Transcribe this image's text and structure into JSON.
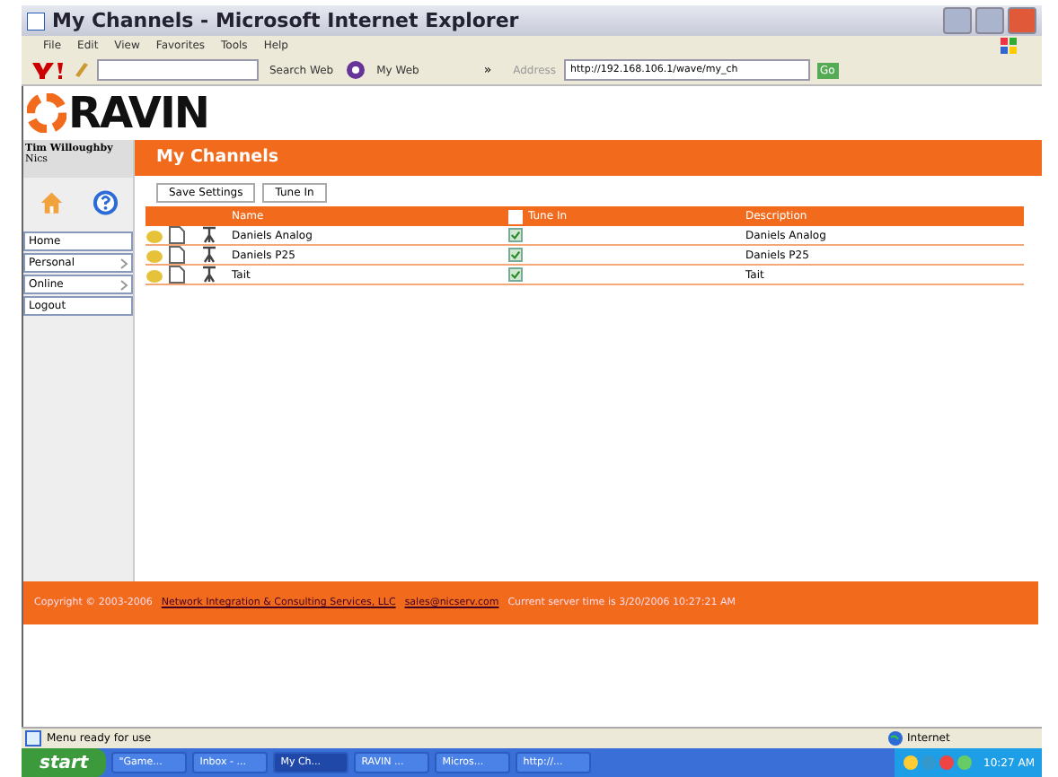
{
  "window": {
    "title": "My Channels - Microsoft Internet Explorer"
  },
  "menu": [
    "File",
    "Edit",
    "View",
    "Favorites",
    "Tools",
    "Help"
  ],
  "toolbar": {
    "search_button": "Search Web",
    "my_web": "My Web",
    "more": "»",
    "address_label": "Address",
    "address": "http://192.168.106.1/wave/my_ch",
    "go": "Go"
  },
  "logo": "RAVIN",
  "user": {
    "name": "Tim Willoughby",
    "org": "Nics"
  },
  "nav": [
    {
      "label": "Home",
      "submenu": false
    },
    {
      "label": "Personal",
      "submenu": true
    },
    {
      "label": "Online",
      "submenu": true
    },
    {
      "label": "Logout",
      "submenu": false
    }
  ],
  "page_title": "My Channels",
  "buttons": [
    "Save Settings",
    "Tune In"
  ],
  "table": {
    "columns": [
      "Name",
      "Tune In",
      "Description"
    ],
    "header_checked": false,
    "rows": [
      {
        "name": "Daniels Analog",
        "tune_in": true,
        "description": "Daniels Analog"
      },
      {
        "name": "Daniels P25",
        "tune_in": true,
        "description": "Daniels P25"
      },
      {
        "name": "Tait",
        "tune_in": true,
        "description": "Tait"
      }
    ]
  },
  "footer": {
    "copyright": "Copyright © 2003-2006",
    "company_link": "Network Integration & Consulting Services, LLC",
    "email_link": "sales@nicserv.com",
    "server_time": "Current server time is 3/20/2006 10:27:21 AM"
  },
  "status_bar": {
    "message": "Menu ready for use",
    "zone": "Internet"
  },
  "taskbar": {
    "start": "start",
    "tasks": [
      {
        "label": "\"Game...",
        "selected": false
      },
      {
        "label": "Inbox - ...",
        "selected": false
      },
      {
        "label": "My Ch...",
        "selected": true
      },
      {
        "label": "RAVIN ...",
        "selected": false
      },
      {
        "label": "Micros...",
        "selected": false
      },
      {
        "label": "http://...",
        "selected": false
      }
    ],
    "clock": "10:27 AM"
  }
}
